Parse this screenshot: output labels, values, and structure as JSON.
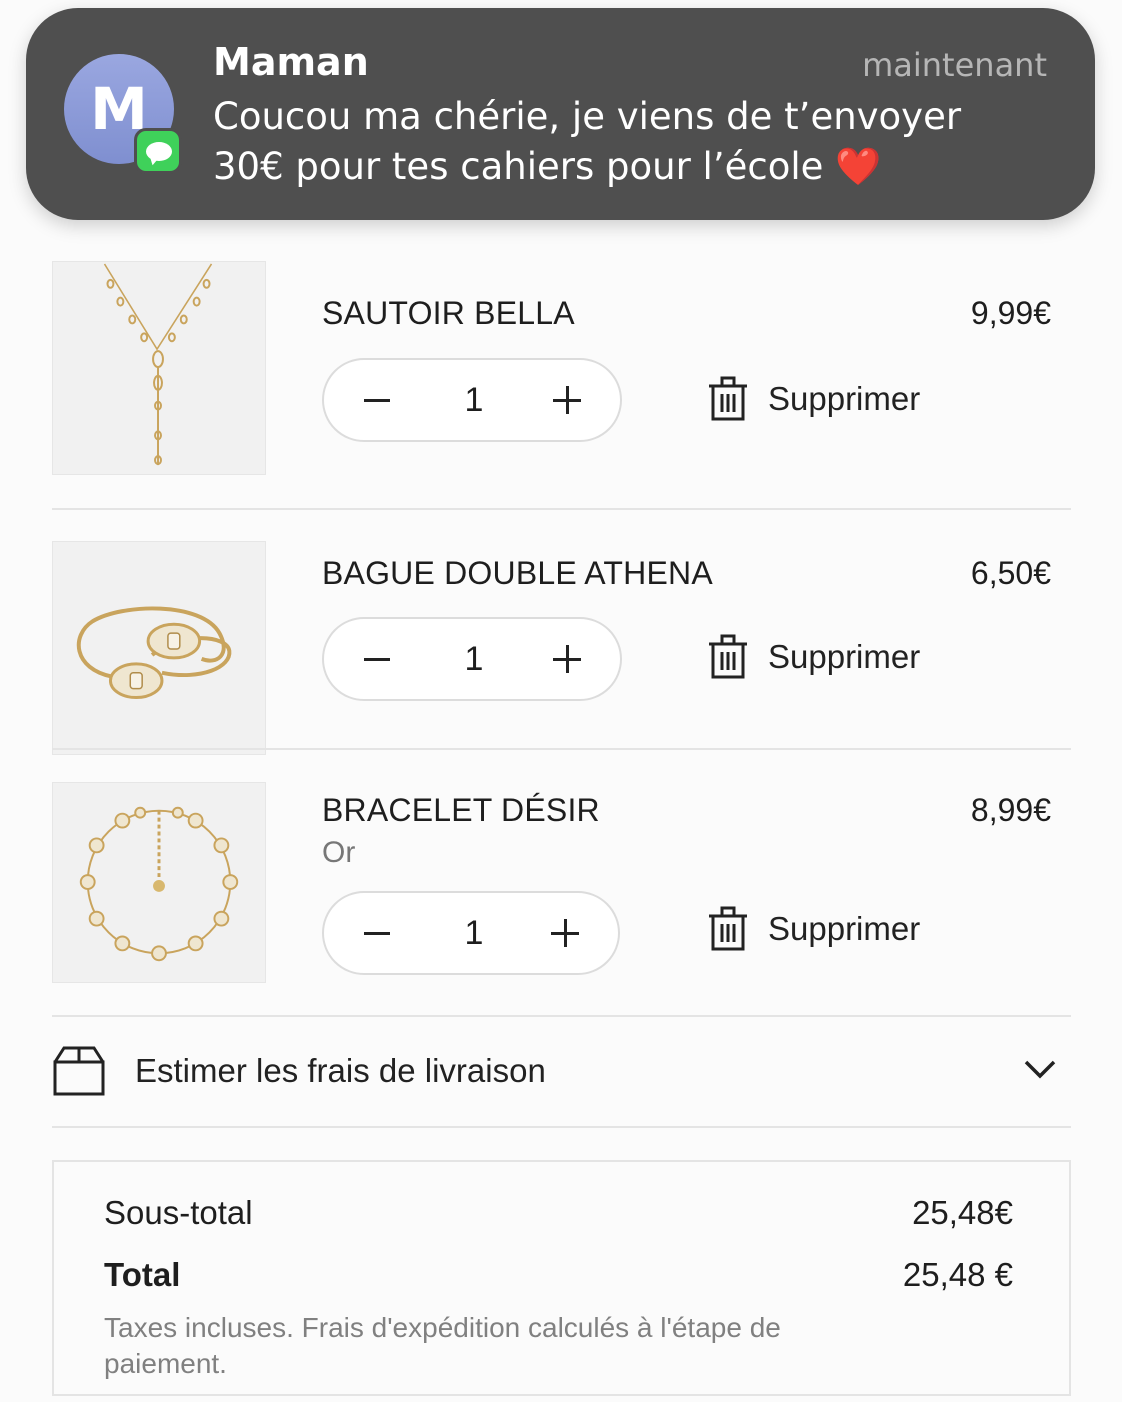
{
  "notification": {
    "avatar_letter": "M",
    "sender": "Maman",
    "time": "maintenant",
    "message": "Coucou ma chérie, je viens de t’envoyer 30€ pour tes cahiers pour l’école ❤️",
    "app_icon": "messages-icon"
  },
  "cart": {
    "items": [
      {
        "name": "SAUTOIR BELLA",
        "variant": "",
        "price": "9,99€",
        "quantity": "1",
        "remove_label": "Supprimer",
        "image": "gold-necklace"
      },
      {
        "name": "BAGUE DOUBLE ATHENA",
        "variant": "",
        "price": "6,50€",
        "quantity": "1",
        "remove_label": "Supprimer",
        "image": "gold-ring"
      },
      {
        "name": "BRACELET DÉSIR",
        "variant": "Or",
        "price": "8,99€",
        "quantity": "1",
        "remove_label": "Supprimer",
        "image": "gold-bracelet"
      }
    ]
  },
  "shipping": {
    "label": "Estimer les frais de livraison"
  },
  "totals": {
    "subtotal_label": "Sous-total",
    "subtotal_value": "25,48€",
    "total_label": "Total",
    "total_value": "25,48 €",
    "note": "Taxes incluses. Frais d'expédition calculés à l'étape de paiement."
  },
  "colors": {
    "notification_bg": "#4f4f4f",
    "avatar": "#8e9ad8",
    "messages_green": "#3fd15a",
    "gold": "#d4b06a"
  }
}
